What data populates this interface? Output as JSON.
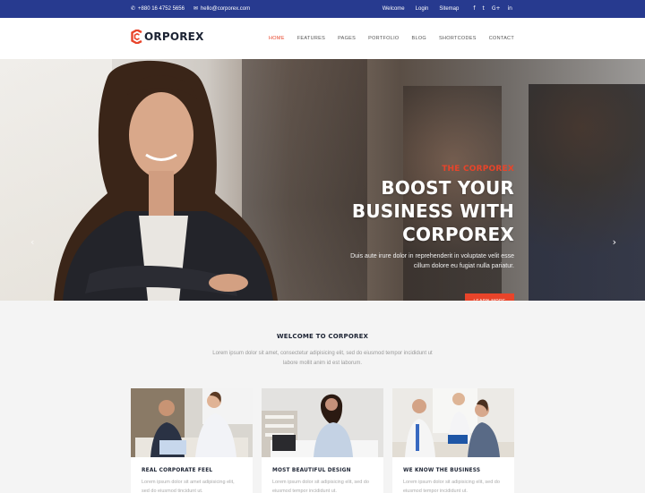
{
  "topbar": {
    "phone": "+880 16 4752 5656",
    "email": "hello@corporex.com",
    "links": [
      "Welcome",
      "Login",
      "Sitemap"
    ],
    "social": [
      "facebook-icon",
      "twitter-icon",
      "google-plus-icon",
      "linkedin-icon"
    ]
  },
  "logo": {
    "mark": "C",
    "text": "ORPOREX"
  },
  "nav": [
    "HOME",
    "FEATURES",
    "PAGES",
    "PORTFOLIO",
    "BLOG",
    "SHORTCODES",
    "CONTACT"
  ],
  "hero": {
    "eyebrow": "THE CORPOREX",
    "headline_1": "BOOST YOUR",
    "headline_2": "BUSINESS WITH",
    "headline_3": "CORPOREX",
    "desc_1": "Duis aute irure dolor in reprehenderit in voluptate velit esse",
    "desc_2": "cillum dolore eu fugiat nulla pariatur.",
    "button": "LEARN MORE",
    "prev_icon": "‹",
    "next_icon": "›"
  },
  "welcome": {
    "title": "WELCOME TO CORPOREX",
    "text": "Lorem ipsum dolor sit amet, consectetur adipisicing elit, sed do eiusmod tempor incididunt ut labore mollit anim id est laborum."
  },
  "cards": [
    {
      "title": "REAL CORPORATE FEEL",
      "text": "Lorem ipsum dolor sit amet adipisicing elit, sed do eiusmod tincidunt ut."
    },
    {
      "title": "MOST BEAUTIFUL DESIGN",
      "text": "Lorem ipsum dolor sit adipisicing elit, sed do eiusmod tempor incididunt ut."
    },
    {
      "title": "WE KNOW THE BUSINESS",
      "text": "Lorem ipsum dolor sit adipisicing elit, sed do eiusmod tempor incididunt ut."
    }
  ],
  "colors": {
    "topbar": "#273a8f",
    "accent": "#e8442a"
  }
}
